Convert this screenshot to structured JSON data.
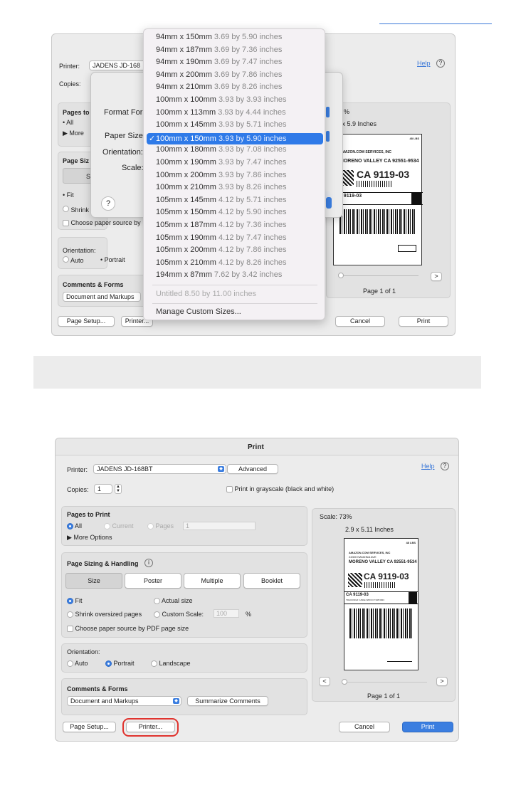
{
  "top_dialog": {
    "printer_label": "Printer:",
    "printer_value": "JADENS JD-168",
    "help": "Help",
    "copies_label": "Copies:",
    "pages_to_label": "Pages to",
    "all": "All",
    "more": "More",
    "page_siz": "Page Siz",
    "si": "Si",
    "fit": "Fit",
    "shrink": "Shrink",
    "choose": "Choose paper source by",
    "orientation": "Orientation:",
    "auto": "Auto",
    "portrait": "Portrait",
    "comments": "Comments & Forms",
    "doc_markups": "Document and Markups",
    "page_setup": "Page Setup...",
    "printer_btn": "Printer...",
    "cancel": "Cancel",
    "print": "Print",
    "scale_frag": "%",
    "size_frag": "3 x 5.9 Inches",
    "page_of": "Page 1 of 1",
    "next": ">",
    "sheet": {
      "format_for": "Format For:",
      "paper_size": "Paper Size:",
      "orientation": "Orientation:",
      "scale": "Scale:",
      "question": "?"
    }
  },
  "menu": {
    "items": [
      {
        "size": "94mm x 150mm",
        "inches": "3.69 by 5.90 inches"
      },
      {
        "size": "94mm x 187mm",
        "inches": "3.69 by 7.36 inches"
      },
      {
        "size": "94mm x 190mm",
        "inches": "3.69 by 7.47 inches"
      },
      {
        "size": "94mm x 200mm",
        "inches": "3.69 by 7.86 inches"
      },
      {
        "size": "94mm x 210mm",
        "inches": "3.69 by 8.26 inches"
      },
      {
        "size": "100mm x 100mm",
        "inches": "3.93 by 3.93 inches"
      },
      {
        "size": "100mm x 113mm",
        "inches": "3.93 by 4.44 inches"
      },
      {
        "size": "100mm x 145mm",
        "inches": "3.93 by 5.71 inches"
      },
      {
        "size": "100mm x 150mm",
        "inches": "3.93 by 5.90 inches"
      },
      {
        "size": "100mm x 180mm",
        "inches": "3.93 by 7.08 inches"
      },
      {
        "size": "100mm x 190mm",
        "inches": "3.93 by 7.47 inches"
      },
      {
        "size": "100mm x 200mm",
        "inches": "3.93 by 7.86 inches"
      },
      {
        "size": "100mm x 210mm",
        "inches": "3.93 by 8.26 inches"
      },
      {
        "size": "105mm x 145mm",
        "inches": "4.12 by 5.71 inches"
      },
      {
        "size": "105mm x 150mm",
        "inches": "4.12 by 5.90 inches"
      },
      {
        "size": "105mm x 187mm",
        "inches": "4.12 by 7.36 inches"
      },
      {
        "size": "105mm x 190mm",
        "inches": "4.12 by 7.47 inches"
      },
      {
        "size": "105mm x 200mm",
        "inches": "4.12 by 7.86 inches"
      },
      {
        "size": "105mm x 210mm",
        "inches": "4.12 by 8.26 inches"
      },
      {
        "size": "194mm x 87mm",
        "inches": "7.62 by 3.42 inches"
      }
    ],
    "selected_check": "✓",
    "untitled": "Untitled 8.50 by 11.00 inches",
    "manage": "Manage Custom Sizes..."
  },
  "dialog": {
    "title": "Print",
    "printer_label": "Printer:",
    "printer_value": "JADENS JD-168BT",
    "advanced": "Advanced",
    "help": "Help",
    "help_icon": "?",
    "copies_label": "Copies:",
    "copies_value": "1",
    "grayscale": "Print in grayscale (black and white)",
    "pages_to_print": "Pages to Print",
    "all": "All",
    "current": "Current",
    "pages": "Pages",
    "pages_value": "1",
    "more_options": "More Options",
    "page_sizing": "Page Sizing & Handling",
    "info_icon": "i",
    "tabs": [
      "Size",
      "Poster",
      "Multiple",
      "Booklet"
    ],
    "fit": "Fit",
    "actual_size": "Actual size",
    "shrink": "Shrink oversized pages",
    "custom_scale": "Custom Scale:",
    "custom_scale_value": "100",
    "percent": "%",
    "choose_source": "Choose paper source by PDF page size",
    "orientation": "Orientation:",
    "auto": "Auto",
    "portrait": "Portrait",
    "landscape": "Landscape",
    "comments_forms": "Comments & Forms",
    "doc_markups": "Document and Markups",
    "summarize": "Summarize Comments",
    "scale": "Scale: 73%",
    "size": "2.9 x 5.11 Inches",
    "prev": "<",
    "next": ">",
    "page_of": "Page 1 of 1",
    "page_setup": "Page Setup...",
    "printer_btn": "Printer...",
    "cancel": "Cancel",
    "print": "Print",
    "highlight_color": "#e0342f"
  },
  "label_preview": {
    "weight": "48 LBS",
    "count": "1 OF 2",
    "company": "AMAZON.COM SERVICES, INC",
    "address": "24300 NANDINA AVE",
    "city": "MORENO VALLEY CA 92551-9534",
    "code": "CA 9119-03",
    "code_small": "CA 9119-03",
    "tracking": "TRACKING#: 1Z91E W83 03 7338 6843"
  }
}
